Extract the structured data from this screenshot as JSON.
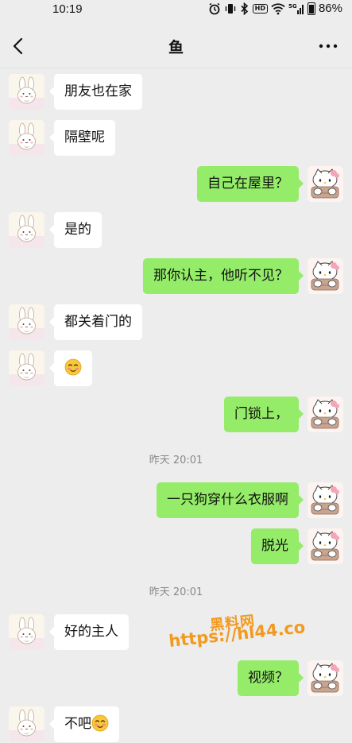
{
  "status_bar": {
    "time": "10:19",
    "battery": "86%",
    "network_badge": "HD",
    "icons": [
      "alarm-icon",
      "vibrate-icon",
      "bluetooth-icon",
      "hd-icon",
      "wifi-icon",
      "signal-5g-icon",
      "battery-icon"
    ]
  },
  "header": {
    "title": "鱼",
    "back_icon": "chevron-left-icon",
    "more_icon": "more-dots-icon"
  },
  "messages": [
    {
      "side": "left",
      "text": "朋友也在家"
    },
    {
      "side": "left",
      "text": "隔壁呢"
    },
    {
      "side": "right",
      "text": "自己在屋里？"
    },
    {
      "side": "left",
      "text": "是的"
    },
    {
      "side": "right",
      "text": "那你认主，他听不见？"
    },
    {
      "side": "left",
      "text": "都关着门的"
    },
    {
      "side": "left",
      "text": "",
      "emoji": "blush-emoji"
    },
    {
      "side": "right",
      "text": "门锁上，"
    },
    {
      "side": "time",
      "text": "昨天 20:01"
    },
    {
      "side": "right",
      "text": "一只狗穿什么衣服啊"
    },
    {
      "side": "right",
      "text": "脱光"
    },
    {
      "side": "time",
      "text": "昨天 20:01"
    },
    {
      "side": "left",
      "text": "好的主人"
    },
    {
      "side": "right",
      "text": "视频？"
    },
    {
      "side": "left",
      "text": "不吧",
      "emoji": "blush-emoji"
    }
  ],
  "watermark": {
    "line1": "黑料网",
    "line2": "https://hl44.co"
  },
  "colors": {
    "background": "#ededed",
    "bubble_left": "#ffffff",
    "bubble_right": "#95ec69",
    "watermark": "#f19a1f"
  }
}
